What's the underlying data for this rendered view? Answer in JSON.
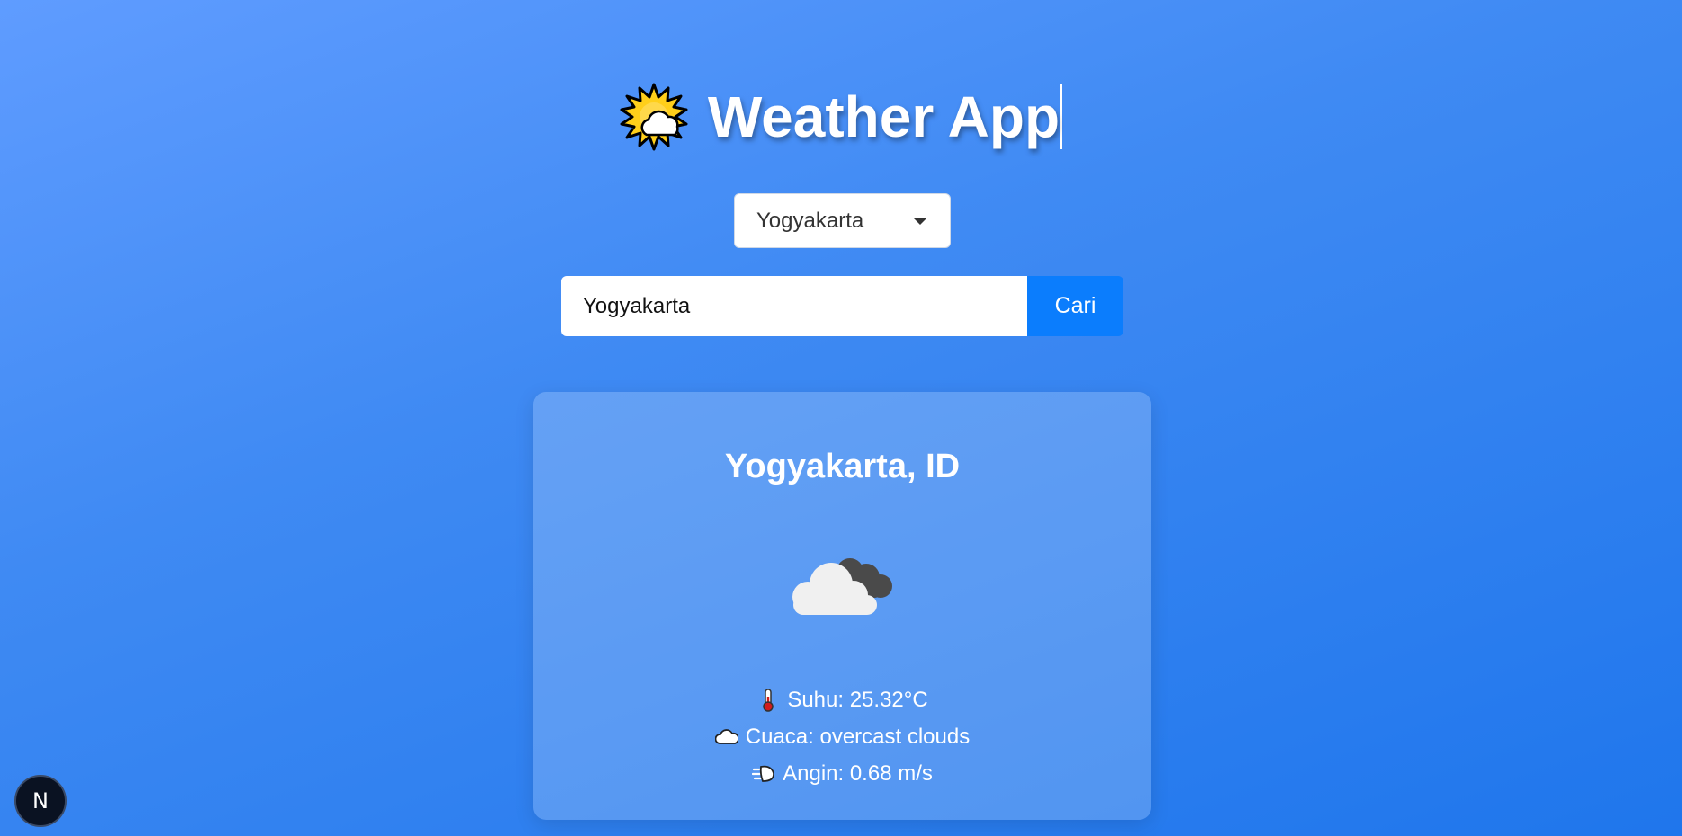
{
  "header": {
    "title": "Weather App",
    "icon": "sun-behind-cloud-icon"
  },
  "city_select": {
    "selected": "Yogyakarta"
  },
  "search": {
    "value": "Yogyakarta",
    "button_label": "Cari"
  },
  "weather": {
    "location": "Yogyakarta, ID",
    "condition_icon": "overcast-clouds-icon",
    "details": {
      "temperature": "Suhu: 25.32°C",
      "condition": "Cuaca: overcast clouds",
      "wind": "Angin: 0.68 m/s"
    }
  },
  "badge": {
    "label": "N"
  },
  "colors": {
    "button": "#0b7dfd",
    "background_start": "#5f9cff",
    "background_end": "#1f76ec"
  }
}
